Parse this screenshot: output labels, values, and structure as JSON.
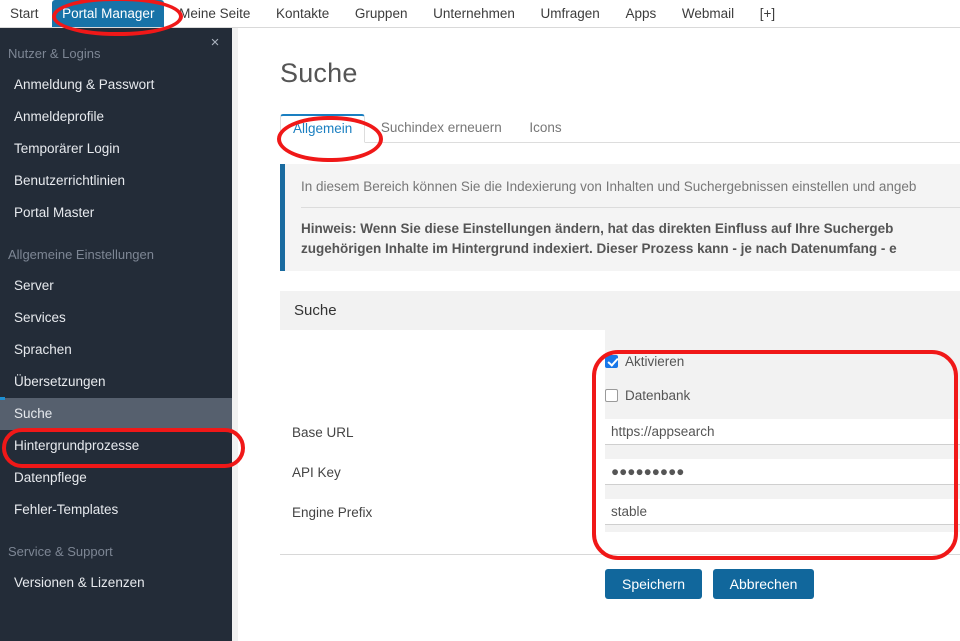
{
  "topnav": {
    "items": [
      {
        "label": "Start",
        "active": false
      },
      {
        "label": "Portal Manager",
        "active": true
      },
      {
        "label": "Meine Seite",
        "active": false
      },
      {
        "label": "Kontakte",
        "active": false
      },
      {
        "label": "Gruppen",
        "active": false
      },
      {
        "label": "Unternehmen",
        "active": false
      },
      {
        "label": "Umfragen",
        "active": false
      },
      {
        "label": "Apps",
        "active": false
      },
      {
        "label": "Webmail",
        "active": false
      },
      {
        "label": "[+]",
        "active": false
      }
    ]
  },
  "sidebar": {
    "close_label": "×",
    "groups": [
      {
        "title": "Nutzer & Logins",
        "items": [
          {
            "label": "Anmeldung & Passwort",
            "selected": false
          },
          {
            "label": "Anmeldeprofile",
            "selected": false
          },
          {
            "label": "Temporärer Login",
            "selected": false
          },
          {
            "label": "Benutzerrichtlinien",
            "selected": false
          },
          {
            "label": "Portal Master",
            "selected": false
          }
        ]
      },
      {
        "title": "Allgemeine Einstellungen",
        "items": [
          {
            "label": "Server",
            "selected": false
          },
          {
            "label": "Services",
            "selected": false
          },
          {
            "label": "Sprachen",
            "selected": false
          },
          {
            "label": "Übersetzungen",
            "selected": false
          },
          {
            "label": "Suche",
            "selected": true
          },
          {
            "label": "Hintergrundprozesse",
            "selected": false
          },
          {
            "label": "Datenpflege",
            "selected": false
          },
          {
            "label": "Fehler-Templates",
            "selected": false
          }
        ]
      },
      {
        "title": "Service & Support",
        "items": [
          {
            "label": "Versionen & Lizenzen",
            "selected": false
          }
        ]
      }
    ]
  },
  "main": {
    "page_title": "Suche",
    "tabs": [
      {
        "label": "Allgemein",
        "active": true
      },
      {
        "label": "Suchindex erneuern",
        "active": false
      },
      {
        "label": "Icons",
        "active": false
      }
    ],
    "alert": {
      "text": "In diesem Bereich können Sie die Indexierung von Inhalten und Suchergebnissen einstellen und angeb",
      "note_line1": "Hinweis: Wenn Sie diese Einstellungen ändern, hat das direkten Einfluss auf Ihre Suchergeb",
      "note_line2": "zugehörigen Inhalte im Hintergrund indexiert. Dieser Prozess kann - je nach Datenumfang - e"
    },
    "section": {
      "title": "Suche",
      "checkboxes": [
        {
          "label": "Aktivieren",
          "checked": true
        },
        {
          "label": "Datenbank",
          "checked": false
        }
      ],
      "fields": [
        {
          "label": "Base URL",
          "value": "https://appsearch",
          "type": "text"
        },
        {
          "label": "API Key",
          "value": "●●●●●●●●●",
          "type": "password"
        },
        {
          "label": "Engine Prefix",
          "value": "stable",
          "type": "text"
        }
      ]
    },
    "actions": {
      "save_label": "Speichern",
      "cancel_label": "Abbrechen"
    }
  },
  "annotations": {
    "color": "#f01818",
    "targets": [
      "portal-manager-tab",
      "allgemein-tab",
      "sidebar-suche-item",
      "search-settings-fields"
    ]
  }
}
